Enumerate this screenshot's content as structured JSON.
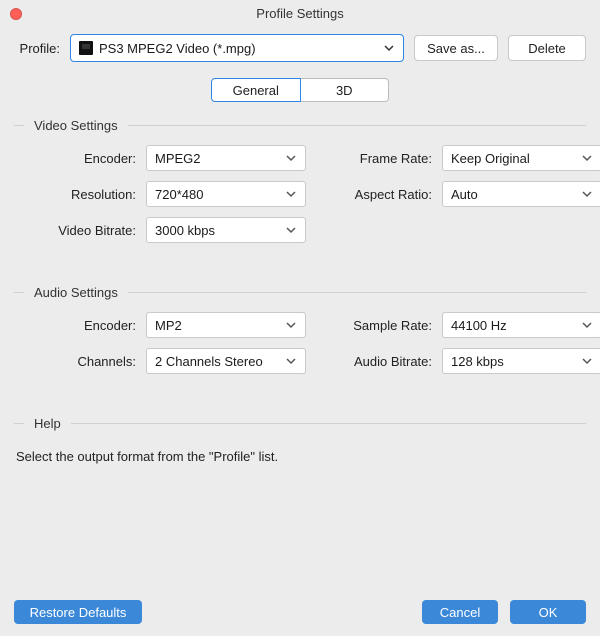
{
  "window": {
    "title": "Profile Settings"
  },
  "profileRow": {
    "label": "Profile:",
    "selected": "PS3 MPEG2 Video (*.mpg)",
    "saveAs": "Save as...",
    "delete": "Delete"
  },
  "tabs": {
    "general": "General",
    "threeD": "3D",
    "active": "general"
  },
  "video": {
    "legend": "Video Settings",
    "fields": {
      "encoder": {
        "label": "Encoder:",
        "value": "MPEG2"
      },
      "frameRate": {
        "label": "Frame Rate:",
        "value": "Keep Original"
      },
      "resolution": {
        "label": "Resolution:",
        "value": "720*480"
      },
      "aspect": {
        "label": "Aspect Ratio:",
        "value": "Auto"
      },
      "bitrate": {
        "label": "Video Bitrate:",
        "value": "3000 kbps"
      }
    }
  },
  "audio": {
    "legend": "Audio Settings",
    "fields": {
      "encoder": {
        "label": "Encoder:",
        "value": "MP2"
      },
      "sampleRate": {
        "label": "Sample Rate:",
        "value": "44100 Hz"
      },
      "channels": {
        "label": "Channels:",
        "value": "2 Channels Stereo"
      },
      "bitrate": {
        "label": "Audio Bitrate:",
        "value": "128 kbps"
      }
    }
  },
  "help": {
    "legend": "Help",
    "text": "Select the output format from the \"Profile\" list."
  },
  "footer": {
    "restore": "Restore Defaults",
    "cancel": "Cancel",
    "ok": "OK"
  }
}
